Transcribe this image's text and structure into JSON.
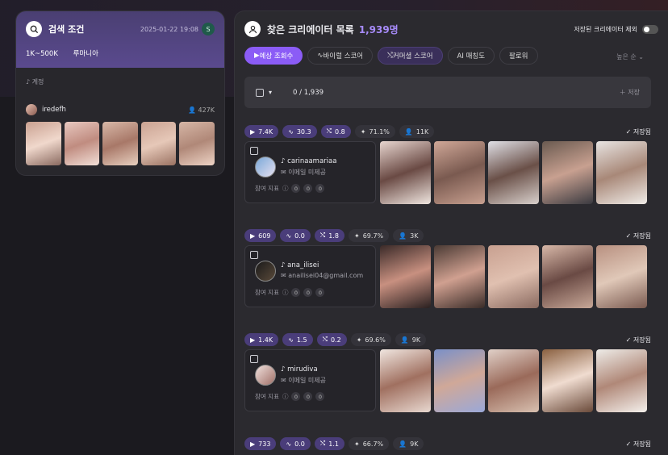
{
  "left": {
    "title": "검색 조건",
    "date": "2025-01-22 19:08",
    "avatar": "S",
    "tags": [
      "1K~500K",
      "루마니아"
    ],
    "account": "계정",
    "user": "iredefh",
    "count": "427K"
  },
  "right": {
    "title": "찾은 크리에이터 목록",
    "count": "1,939명",
    "exclude": "저장된 크리에이터 제외",
    "sort": "높은 순",
    "tabs": [
      "예상 조회수",
      "바이럴 스코어",
      "커머셜 스코어",
      "AI 매칭도",
      "팔로워"
    ],
    "selected": "0 / 1,939",
    "save": "저장",
    "saved": "저장됨",
    "metric_label": "참여 지표",
    "missing_email": "이메일 미제공"
  },
  "creators": [
    {
      "views": "7.4K",
      "viral": "30.3",
      "commercial": "0.8",
      "ai": "71.1%",
      "followers": "11K",
      "name": "carinaamariaa",
      "email": "이메일 미제공",
      "m": [
        "0",
        "0",
        "0"
      ]
    },
    {
      "views": "609",
      "viral": "0.0",
      "commercial": "1.8",
      "ai": "69.7%",
      "followers": "3K",
      "name": "ana_ilisei",
      "email": "anailisei04@gmail.com",
      "m": [
        "0",
        "0",
        "0"
      ]
    },
    {
      "views": "1.4K",
      "viral": "1.5",
      "commercial": "0.2",
      "ai": "69.6%",
      "followers": "9K",
      "name": "mirudiva",
      "email": "이메일 미제공",
      "m": [
        "0",
        "0",
        "0"
      ]
    },
    {
      "views": "733",
      "viral": "0.0",
      "commercial": "1.1",
      "ai": "66.7%",
      "followers": "9K"
    }
  ]
}
